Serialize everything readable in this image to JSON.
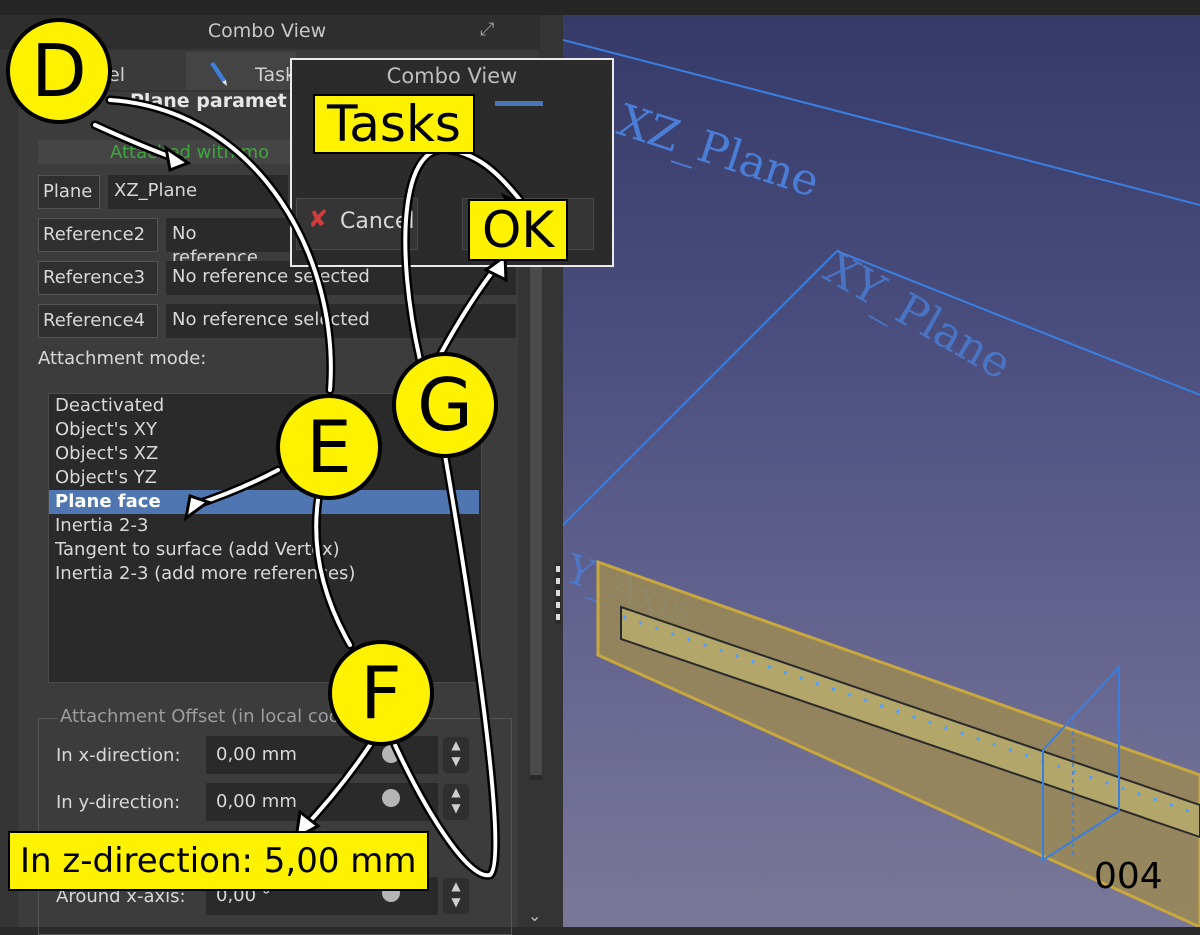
{
  "panel": {
    "title": "Combo View",
    "tabs": [
      {
        "label": "el",
        "name": "Model"
      },
      {
        "label": "Task",
        "name": "Tasks"
      }
    ],
    "section_title": "Plane paramet",
    "status_text": "Attached with mo"
  },
  "references": [
    {
      "label": "Plane",
      "value": "XZ_Plane"
    },
    {
      "label": "Reference2",
      "value": "No reference"
    },
    {
      "label": "Reference3",
      "value": "No reference selected"
    },
    {
      "label": "Reference4",
      "value": "No reference selected"
    }
  ],
  "attachment": {
    "label": "Attachment mode:",
    "modes": [
      "Deactivated",
      "Object's XY",
      "Object's XZ",
      "Object's YZ",
      "Plane face",
      "Inertia 2-3",
      "Tangent to surface (add Vertex)",
      "Inertia 2-3 (add more references)"
    ],
    "selected": "Plane face"
  },
  "offset": {
    "group_title": "Attachment Offset (in local coordinates):",
    "rows": [
      {
        "label": "In x-direction:",
        "value": "0,00 mm"
      },
      {
        "label": "In y-direction:",
        "value": "0,00 mm"
      },
      {
        "label": "Around x-axis:",
        "value": "0,00 °"
      }
    ]
  },
  "inset": {
    "title": "Combo View",
    "tab": "Tasks",
    "cancel": "Cancel",
    "ok": "OK"
  },
  "callouts": {
    "d": "D",
    "e": "E",
    "f": "F",
    "g": "G",
    "tasks": "Tasks",
    "ok": "OK",
    "z_direction": "In z-direction: 5,00 mm"
  },
  "viewport": {
    "plane_labels": [
      "XZ_Plane",
      "XY_Plane"
    ],
    "axis_label": "Y_Axis"
  },
  "frame_number": "004",
  "colors": {
    "highlight": "#fff200",
    "selection": "#4f76b0",
    "plane_lines": "#3a7fe0",
    "status_green": "#3fa63f"
  }
}
